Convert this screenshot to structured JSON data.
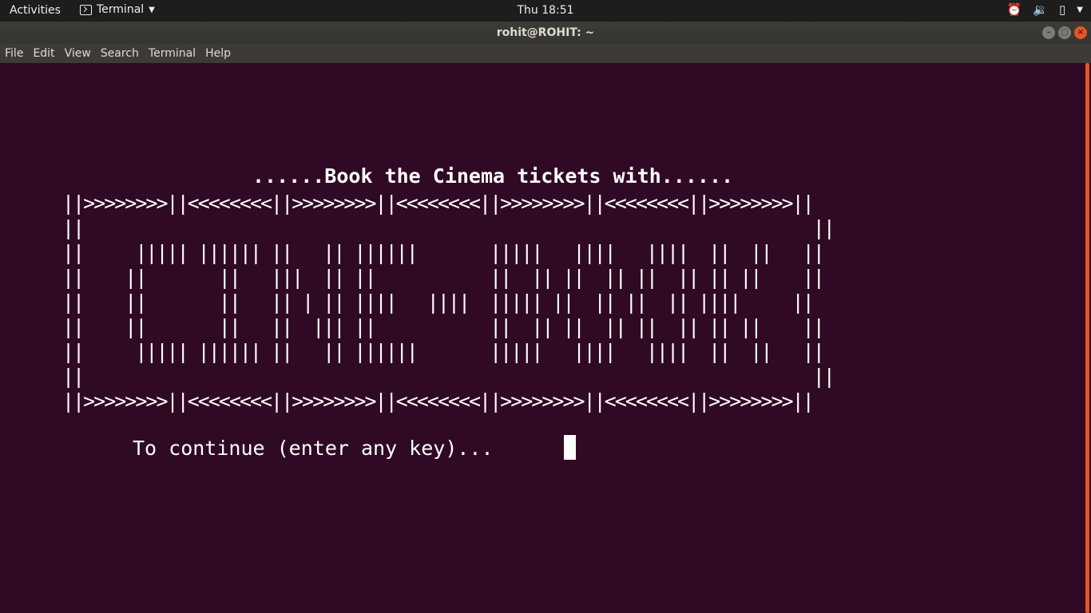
{
  "topbar": {
    "activities": "Activities",
    "app_name": "Terminal",
    "clock": "Thu 18:51",
    "tray_icons": [
      "alarm-icon",
      "volume-icon",
      "battery-icon",
      "chevron-down-icon"
    ]
  },
  "window": {
    "title": "rohit@ROHIT: ~",
    "accent": "#e95420",
    "background": "#300a24"
  },
  "menu": {
    "items": [
      "File",
      "Edit",
      "View",
      "Search",
      "Terminal",
      "Help"
    ]
  },
  "terminal": {
    "heading": "......Book the Cinema tickets with......",
    "banner_lines": [
      "||>>>>>>>>||<<<<<<<<||>>>>>>>>||<<<<<<<<||>>>>>>>>||<<<<<<<<||>>>>>>>>||",
      "||                                                                      ||",
      "||     ||||| |||||| ||   || ||||||       |||||   ||||   ||||  ||  ||   ||",
      "||    ||       ||   |||  || ||           ||  || ||  || ||  || || ||    ||",
      "||    ||       ||   || | || ||||   ||||  ||||| ||  || ||  || ||||     ||",
      "||    ||       ||   ||  ||| ||           ||  || ||  || ||  || || ||    ||",
      "||     ||||| |||||| ||   || ||||||       |||||   ||||   ||||  ||  ||   ||",
      "||                                                                      ||",
      "||>>>>>>>>||<<<<<<<<||>>>>>>>>||<<<<<<<<||>>>>>>>>||<<<<<<<<||>>>>>>>>||"
    ],
    "prompt": "To continue (enter any key)..."
  }
}
